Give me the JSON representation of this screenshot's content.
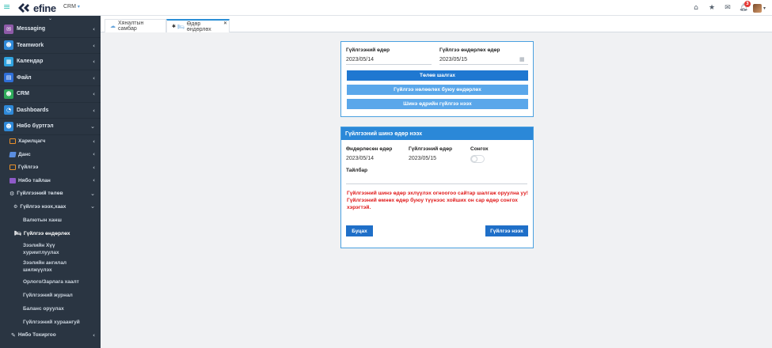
{
  "app": {
    "logo_text": "efine",
    "module_menu": "CRM",
    "notification_count": "3"
  },
  "sidebar": {
    "items": [
      {
        "label": "Messaging",
        "icon": "chat-icon",
        "color": "#8e5aa8"
      },
      {
        "label": "Teamwork",
        "icon": "user-icon",
        "color": "#2f89d8"
      },
      {
        "label": "Календар",
        "icon": "calendar-icon",
        "color": "#2fa3e0"
      },
      {
        "label": "Файл",
        "icon": "file-icon",
        "color": "#2f6fd8"
      },
      {
        "label": "CRM",
        "icon": "user-icon",
        "color": "#2eaa5a"
      },
      {
        "label": "Dashboards",
        "icon": "dashboard-icon",
        "color": "#2f89d8"
      },
      {
        "label": "Нябо бүртгэл",
        "icon": "user-icon",
        "color": "#2f89d8"
      }
    ],
    "sub_items": [
      {
        "label": "Харилцагч",
        "color": "#e8902a"
      },
      {
        "label": "Данс",
        "color": "#5b8ee0"
      },
      {
        "label": "Гүйлгээ",
        "color": "#e8902a"
      },
      {
        "label": "Нябо тайлан",
        "color": "#8e5ac8"
      }
    ],
    "settlement_group": "Гүйлгээний төлөв",
    "settlement_sub": "Гүйлгээ нээх,хаах",
    "leaves": [
      "Валютын ханш",
      "Гүйлгээ өндөрлөх",
      "Зээлийн Хүү хуримтлуулах",
      "Зээлийн ангилал шилжүүлэх",
      "Орлого/Зарлага хаалт",
      "Гүйлгээний журнал",
      "Баланс оруулах",
      "Гүйлгээний хураангуй"
    ],
    "settings": "Нябо Тохиргоо"
  },
  "tabs": [
    {
      "label": "Хяналтын самбар",
      "icon": "dashboard-icon"
    },
    {
      "label": "Өдөр өндөрлөх",
      "icon": "bed-icon",
      "active": true
    }
  ],
  "close_card": {
    "trans_date_label": "Гүйлгээний өдөр",
    "trans_date_value": "2023/05/14",
    "close_date_label": "Гүйлгээ өндөрлөх өдөр",
    "close_date_value": "2023/05/15",
    "buttons": {
      "check": "Төлөв шалгах",
      "close_pending": "Гүйлгээ нөлөөлөх буюу өндөрлөх",
      "open_new": "Шинэ өдрийн гүйлгээ нээх"
    }
  },
  "open_card": {
    "title": "Гүйлгээний шинэ өдөр нээх",
    "closed_date_label": "Өндөрлөсөн өдөр",
    "closed_date_value": "2023/05/14",
    "trans_date_label": "Гүйлгээний өдөр",
    "trans_date_value": "2023/05/15",
    "choose_label": "Сонгох",
    "note_label": "Тайлбар",
    "note_value": "",
    "warning": "Гүйлгээний шинэ өдөр эхлүүлэх огноогоо сайтар шалгаж оруулна уу! Гүйлгээний өмнөх өдөр буюу түүнээс хойших он сар өдөр сонгох хэрэгтэй.",
    "cancel": "Буцах",
    "open": "Гүйлгээ нээх",
    "toggle_on": false
  }
}
